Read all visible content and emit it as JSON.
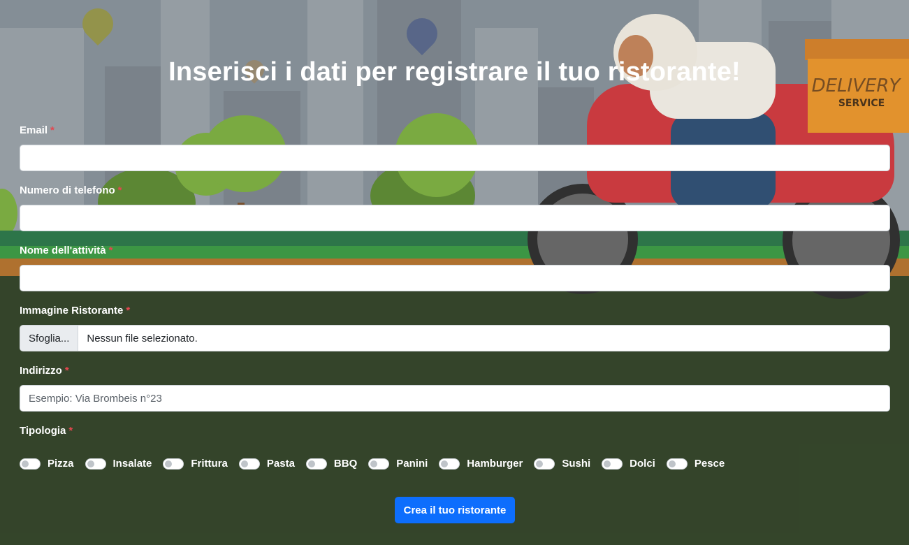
{
  "page_title": "Inserisci i dati per registrare il tuo ristorante!",
  "required_marker": "*",
  "fields": {
    "email": {
      "label": "Email",
      "value": "",
      "placeholder": ""
    },
    "phone": {
      "label": "Numero di telefono",
      "value": "",
      "placeholder": ""
    },
    "business_name": {
      "label": "Nome dell'attività",
      "value": "",
      "placeholder": ""
    },
    "image": {
      "label": "Immagine Ristorante",
      "button_label": "Sfoglia...",
      "status": "Nessun file selezionato."
    },
    "address": {
      "label": "Indirizzo",
      "value": "",
      "placeholder": "Esempio: Via Brombeis n°23"
    },
    "type": {
      "label": "Tipologia"
    }
  },
  "categories": [
    "Pizza",
    "Insalate",
    "Frittura",
    "Pasta",
    "BBQ",
    "Panini",
    "Hamburger",
    "Sushi",
    "Dolci",
    "Pesce"
  ],
  "categories_checked": [
    false,
    false,
    false,
    false,
    false,
    false,
    false,
    false,
    false,
    false
  ],
  "submit_label": "Crea il tuo ristorante",
  "background": {
    "box_text_top": "DELIVERY",
    "box_text_bottom": "SERVICE"
  },
  "colors": {
    "accent": "#0d6efd",
    "required": "#e4474f",
    "grass": "#233518"
  },
  "icons": [
    "map-pin-icon",
    "delivery-scooter-illustration"
  ]
}
